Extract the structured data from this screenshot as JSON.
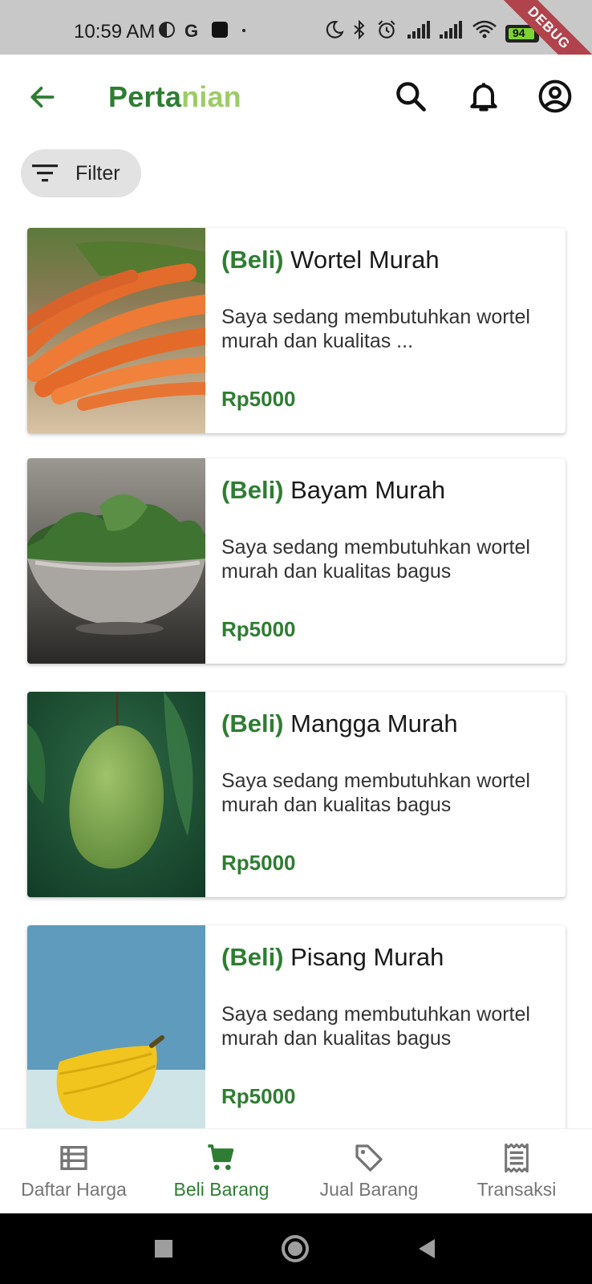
{
  "status_bar": {
    "time": "10:59 AM",
    "battery": "94",
    "debug_label": "DEBUG",
    "icons": [
      "app-icon",
      "g-icon",
      "square-icon",
      "dot-icon",
      "moon-icon",
      "bluetooth-icon",
      "alarm-icon",
      "signal-icon",
      "signal-icon",
      "wifi-icon",
      "battery-icon"
    ]
  },
  "app_bar": {
    "title_part1": "Perta",
    "title_part2": "nian",
    "icons": [
      "back-arrow-icon",
      "search-icon",
      "bell-icon",
      "account-circle-icon"
    ]
  },
  "filter": {
    "label": "Filter",
    "icon": "filter-list-icon"
  },
  "products": [
    {
      "tag": "(Beli)",
      "name": "Wortel Murah",
      "description": "Saya sedang membutuhkan wortel murah dan kualitas ...",
      "price": "Rp5000",
      "image": "carrots-photo"
    },
    {
      "tag": "(Beli)",
      "name": "Bayam Murah",
      "description": "Saya sedang membutuhkan wortel murah dan kualitas bagus",
      "price": "Rp5000",
      "image": "spinach-bowl-photo"
    },
    {
      "tag": "(Beli)",
      "name": "Mangga Murah",
      "description": "Saya sedang membutuhkan wortel murah dan kualitas bagus",
      "price": "Rp5000",
      "image": "mango-photo"
    },
    {
      "tag": "(Beli)",
      "name": "Pisang Murah",
      "description": "Saya sedang membutuhkan wortel murah dan kualitas bagus",
      "price": "Rp5000",
      "image": "banana-photo"
    }
  ],
  "bottom_nav": {
    "items": [
      {
        "label": "Daftar Harga",
        "icon": "list-icon",
        "active": false
      },
      {
        "label": "Beli Barang",
        "icon": "cart-icon",
        "active": true
      },
      {
        "label": "Jual Barang",
        "icon": "tag-icon",
        "active": false
      },
      {
        "label": "Transaksi",
        "icon": "receipt-icon",
        "active": false
      }
    ]
  },
  "colors": {
    "primary": "#2e7d32",
    "primary_light": "#9ccc65",
    "inactive": "#757575",
    "chip_bg": "#e2e2e2",
    "status_bar_bg": "#c8c8c8"
  }
}
